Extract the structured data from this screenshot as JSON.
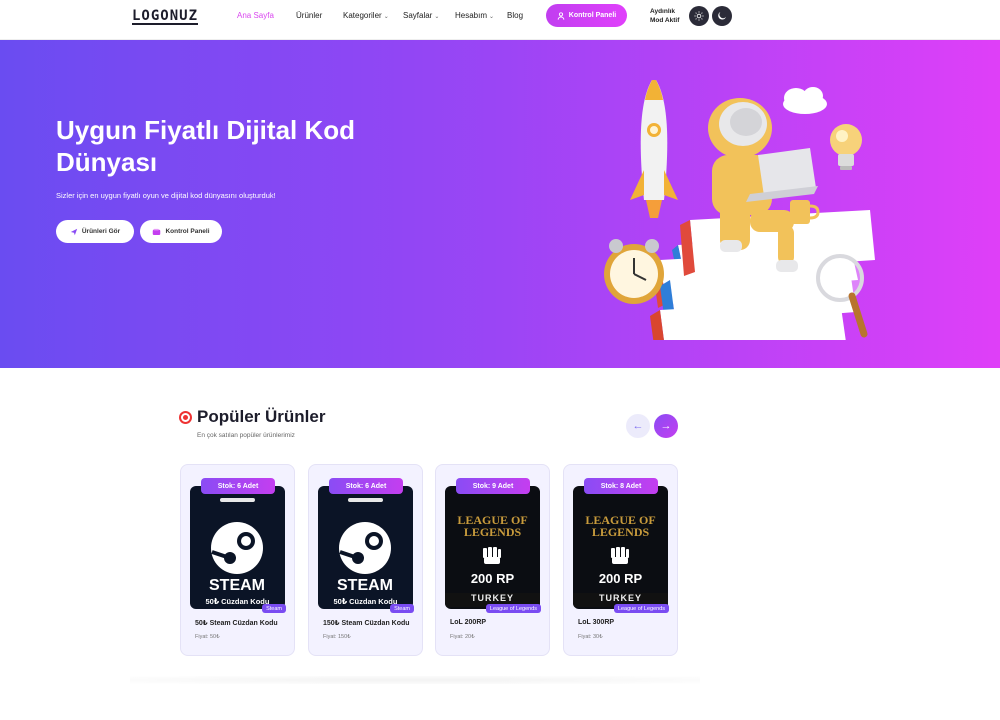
{
  "header": {
    "logo": "LOGONUZ",
    "nav": [
      {
        "label": "Ana Sayfa",
        "active": true,
        "dropdown": false
      },
      {
        "label": "Ürünler",
        "active": false,
        "dropdown": false
      },
      {
        "label": "Kategoriler",
        "active": false,
        "dropdown": true
      },
      {
        "label": "Sayfalar",
        "active": false,
        "dropdown": true
      },
      {
        "label": "Hesabım",
        "active": false,
        "dropdown": true
      },
      {
        "label": "Blog",
        "active": false,
        "dropdown": false
      }
    ],
    "panel_button": "Kontrol Paneli",
    "mode_line1": "Aydınlık",
    "mode_line2": "Mod Aktif"
  },
  "hero": {
    "title": "Uygun Fiyatlı Dijital Kod Dünyası",
    "subtitle": "Sizler için en uygun fiyatlı oyun ve dijital kod dünyasını oluşturduk!",
    "btn_products": "Ürünleri Gör",
    "btn_panel": "Kontrol Paneli"
  },
  "section": {
    "title": "Popüler Ürünler",
    "subtitle": "En çok satılan popüler ürünlerimiz"
  },
  "products": [
    {
      "stock": "Stok: 6 Adet",
      "name": "50₺ Steam Cüzdan Kodu",
      "price": "Fiyat: 50₺",
      "tag": "Steam",
      "img_text": "STEAM",
      "img_caption": "50₺ Cüzdan Kodu"
    },
    {
      "stock": "Stok: 6 Adet",
      "name": "150₺ Steam Cüzdan Kodu",
      "price": "Fiyat: 150₺",
      "tag": "Steam",
      "img_text": "STEAM",
      "img_caption": "50₺ Cüzdan Kodu"
    },
    {
      "stock": "Stok: 9 Adet",
      "name": "LoL 200RP",
      "price": "Fiyat: 20₺",
      "tag": "League of Legends",
      "img_title": "LEAGUE OF LEGENDS",
      "img_rp": "200 RP",
      "img_region": "TURKEY"
    },
    {
      "stock": "Stok: 8 Adet",
      "name": "LoL 300RP",
      "price": "Fiyat: 30₺",
      "tag": "League of Legends",
      "img_title": "LEAGUE OF LEGENDS",
      "img_rp": "200 RP",
      "img_region": "TURKEY"
    }
  ],
  "colors": {
    "accent": "#d946ef",
    "hero_start": "#6a4cf1",
    "hero_end": "#df3ff8"
  }
}
